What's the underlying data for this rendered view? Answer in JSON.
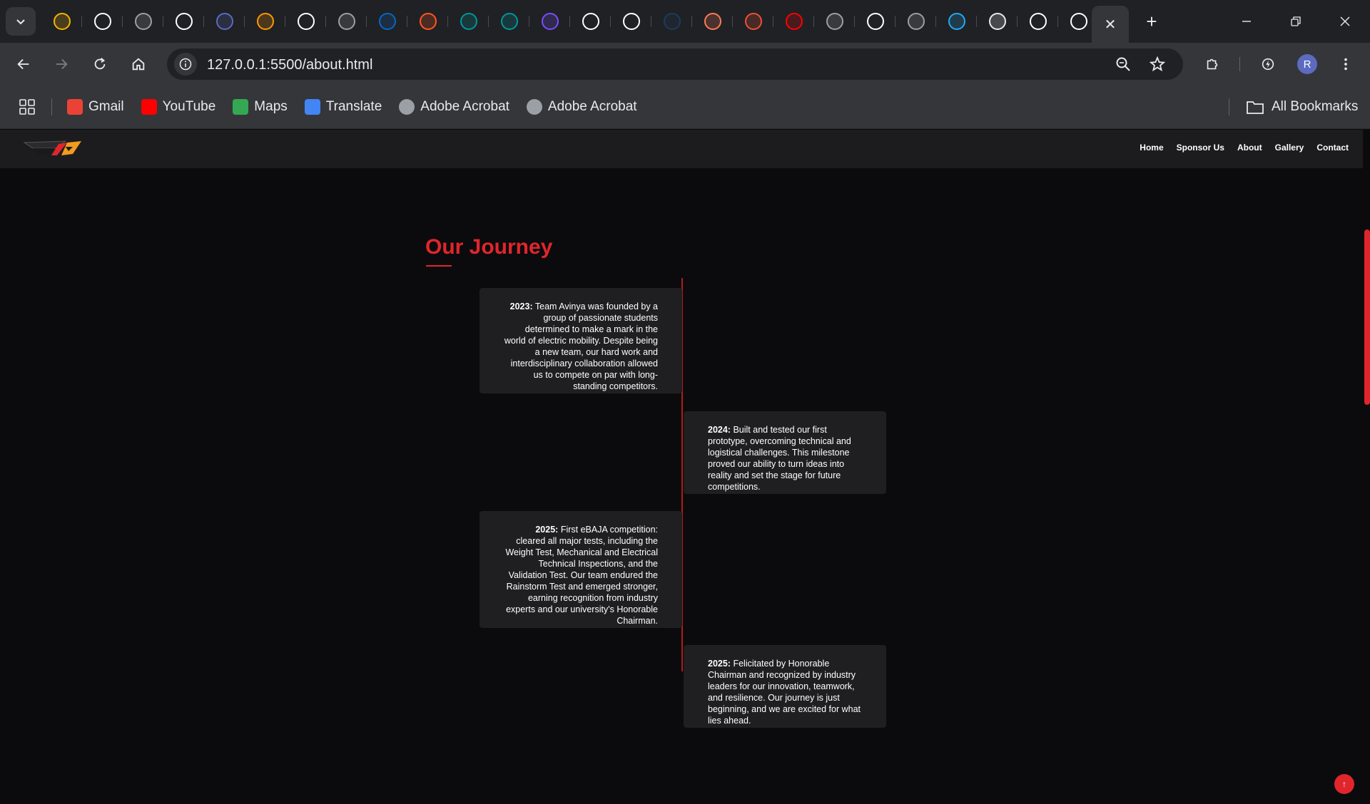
{
  "browser": {
    "pinned_tabs": [
      {
        "icon": "google-drive-icon",
        "color": "#f4b400"
      },
      {
        "icon": "google-icon",
        "color": "#ffffff"
      },
      {
        "icon": "cisco-icon",
        "color": "#9aa0a6"
      },
      {
        "icon": "google-icon",
        "color": "#ffffff"
      },
      {
        "icon": "code-editor-icon",
        "color": "#5c6bc0"
      },
      {
        "icon": "game-icon",
        "color": "#ff9800"
      },
      {
        "icon": "google-icon",
        "color": "#ffffff"
      },
      {
        "icon": "globe-icon",
        "color": "#9aa0a6"
      },
      {
        "icon": "linkedin-icon",
        "color": "#0a66c2"
      },
      {
        "icon": "bolt-icon",
        "color": "#ff5722"
      },
      {
        "icon": "arduino-icon",
        "color": "#00979d"
      },
      {
        "icon": "arduino-icon",
        "color": "#00979d"
      },
      {
        "icon": "canva-icon",
        "color": "#7b4dff"
      },
      {
        "icon": "google-icon",
        "color": "#ffffff"
      },
      {
        "icon": "github-icon",
        "color": "#ffffff"
      },
      {
        "icon": "terminal-icon",
        "color": "#1e3a5f"
      },
      {
        "icon": "hubspot-icon",
        "color": "#ff7a59"
      },
      {
        "icon": "git-icon",
        "color": "#f05033"
      },
      {
        "icon": "youtube-icon",
        "color": "#ff0000"
      },
      {
        "icon": "chrome-icon",
        "color": "#9aa0a6"
      },
      {
        "icon": "github-icon",
        "color": "#ffffff"
      },
      {
        "icon": "chrome-icon",
        "color": "#9aa0a6"
      },
      {
        "icon": "vscode-icon",
        "color": "#23a9f2"
      },
      {
        "icon": "ai-icon",
        "color": "#e8eaed"
      },
      {
        "icon": "github-icon",
        "color": "#ffffff"
      },
      {
        "icon": "google-icon",
        "color": "#ffffff"
      }
    ],
    "address": "127.0.0.1:5500/about.html",
    "avatar_initial": "R",
    "bookmarks": [
      {
        "label": "Gmail",
        "icon": "gmail-icon",
        "color": "#ea4335"
      },
      {
        "label": "YouTube",
        "icon": "youtube-icon",
        "color": "#ff0000"
      },
      {
        "label": "Maps",
        "icon": "maps-icon",
        "color": "#34a853"
      },
      {
        "label": "Translate",
        "icon": "translate-icon",
        "color": "#4285f4"
      },
      {
        "label": "Adobe Acrobat",
        "icon": "globe-icon",
        "color": "#9aa0a6"
      },
      {
        "label": "Adobe Acrobat",
        "icon": "globe-icon",
        "color": "#9aa0a6"
      }
    ],
    "all_bookmarks": "All Bookmarks"
  },
  "site": {
    "nav": [
      "Home",
      "Sponsor Us",
      "About",
      "Gallery",
      "Contact"
    ],
    "journey_title": "Our Journey",
    "accent": "#e0262c",
    "timeline": [
      {
        "year": "2023:",
        "text": "Team Avinya was founded by a group of passionate students determined to make a mark in the world of electric mobility. Despite being a new team, our hard work and interdisciplinary collaboration allowed us to compete on par with long-standing competitors.",
        "side": "left"
      },
      {
        "year": "2024:",
        "text": "Built and tested our first prototype, overcoming technical and logistical challenges. This milestone proved our ability to turn ideas into reality and set the stage for future competitions.",
        "side": "right"
      },
      {
        "year": "2025:",
        "text": "First eBAJA competition: cleared all major tests, including the Weight Test, Mechanical and Electrical Technical Inspections, and the Validation Test. Our team endured the Rainstorm Test and emerged stronger, earning recognition from industry experts and our university's Honorable Chairman.",
        "side": "left"
      },
      {
        "year": "2025:",
        "text": "Felicitated by Honorable Chairman and recognized by industry leaders for our innovation, teamwork, and resilience. Our journey is just beginning, and we are excited for what lies ahead.",
        "side": "right"
      }
    ],
    "to_top": "↑"
  }
}
